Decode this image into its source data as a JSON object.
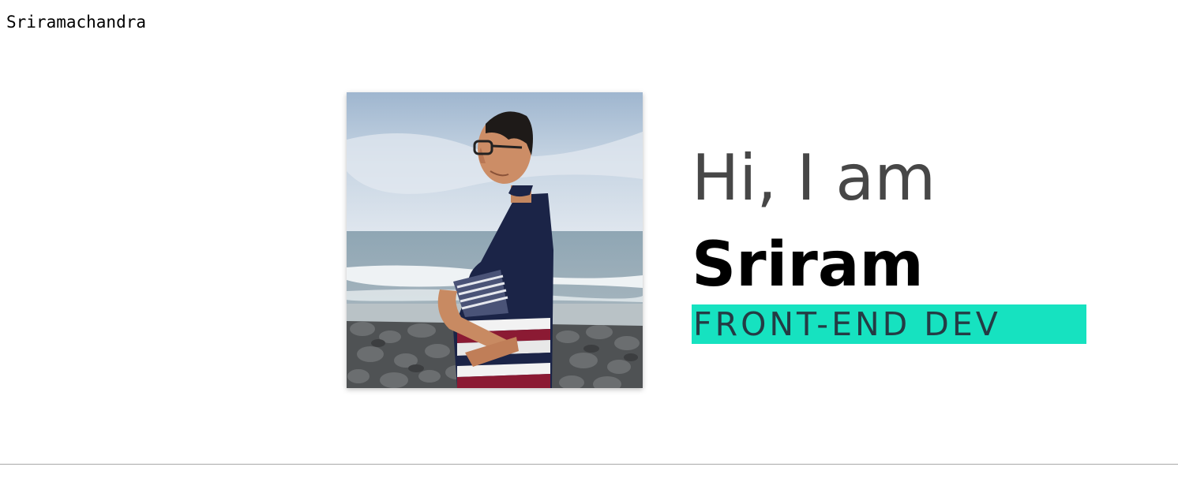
{
  "header": {
    "brand_name": "Sriramachandra"
  },
  "hero": {
    "photo_alt": "profile-photo",
    "greeting": "Hi, I am",
    "name": "Sriram",
    "role": "FRONT-END DEV",
    "accent_color": "#16e2c0"
  }
}
